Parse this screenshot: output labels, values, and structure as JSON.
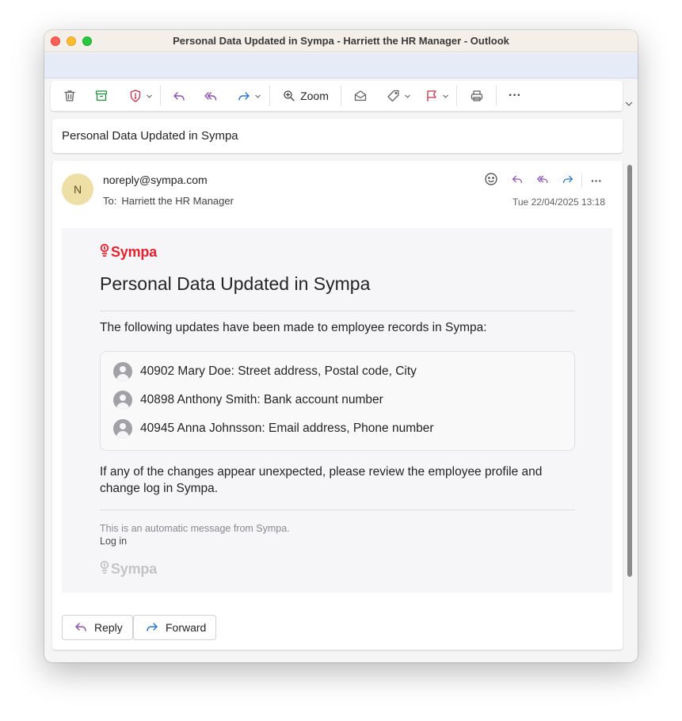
{
  "window": {
    "title": "Personal Data Updated in Sympa - Harriett the HR Manager - Outlook"
  },
  "toolbar": {
    "items": [
      "delete-icon",
      "archive-icon",
      "report-icon",
      "reply-icon",
      "reply-all-icon",
      "forward-icon",
      "zoom-icon",
      "read-unread-icon",
      "tag-icon",
      "flag-icon",
      "print-icon",
      "more-icon"
    ],
    "zoom_label": "Zoom",
    "more_label": "···"
  },
  "message": {
    "subject": "Personal Data Updated in Sympa",
    "avatar_initial": "N",
    "sender": "noreply@sympa.com",
    "to_label": "To:",
    "recipient": "Harriett the HR Manager",
    "date": "Tue 22/04/2025 13:18",
    "more_label": "···"
  },
  "email_body": {
    "brand": "Sympa",
    "heading": "Personal Data Updated in Sympa",
    "intro": "The following updates have been made to employee records in Sympa:",
    "updates": [
      "40902 Mary Doe: Street address, Postal code, City",
      "40898 Anthony Smith: Bank account number",
      "40945 Anna Johnsson: Email address, Phone number"
    ],
    "note": "If any of the changes appear unexpected, please review the employee profile and change log in Sympa.",
    "automatic_note": "This is an automatic message from Sympa.",
    "login_link": "Log in",
    "footer_brand": "Sympa"
  },
  "actions": {
    "reply_label": "Reply",
    "forward_label": "Forward"
  },
  "colors": {
    "accent_purple": "#8a4fb0",
    "forward_blue": "#2a73c5",
    "sympa_red": "#e8212f",
    "avatar_bg": "#eddfa5"
  }
}
